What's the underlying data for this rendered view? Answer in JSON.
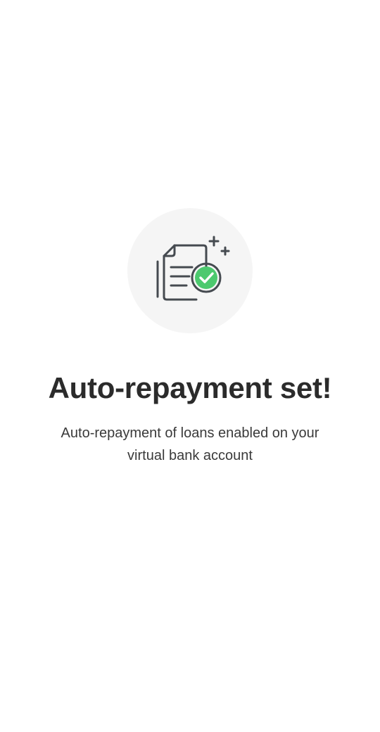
{
  "success": {
    "icon": "document-check-icon",
    "title": "Auto-repayment set!",
    "message": "Auto-repayment of loans enabled on your virtual bank account"
  },
  "colors": {
    "background": "#ffffff",
    "icon_circle": "#f5f5f5",
    "icon_stroke": "#454a50",
    "check_green": "#4cc96e",
    "title_text": "#2b2b2b",
    "body_text": "#3a3a3a"
  }
}
